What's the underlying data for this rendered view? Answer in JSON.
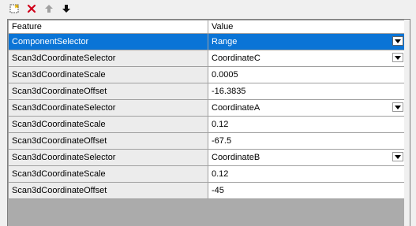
{
  "header": {
    "feature": "Feature",
    "value": "Value"
  },
  "rows": [
    {
      "feature": "ComponentSelector",
      "value": "Range",
      "dropdown": true,
      "selected": true
    },
    {
      "feature": "Scan3dCoordinateSelector",
      "value": "CoordinateC",
      "dropdown": true
    },
    {
      "feature": "Scan3dCoordinateScale",
      "value": "0.0005"
    },
    {
      "feature": "Scan3dCoordinateOffset",
      "value": "-16.3835"
    },
    {
      "feature": "Scan3dCoordinateSelector",
      "value": "CoordinateA",
      "dropdown": true
    },
    {
      "feature": "Scan3dCoordinateScale",
      "value": "0.12"
    },
    {
      "feature": "Scan3dCoordinateOffset",
      "value": "-67.5"
    },
    {
      "feature": "Scan3dCoordinateSelector",
      "value": "CoordinateB",
      "dropdown": true
    },
    {
      "feature": "Scan3dCoordinateScale",
      "value": "0.12"
    },
    {
      "feature": "Scan3dCoordinateOffset",
      "value": "-45"
    }
  ],
  "toolbar_icons": [
    "new-icon",
    "delete-icon",
    "move-up-icon",
    "move-down-icon"
  ],
  "colors": {
    "selection": "#0a74d6",
    "delete": "#d0021b"
  }
}
